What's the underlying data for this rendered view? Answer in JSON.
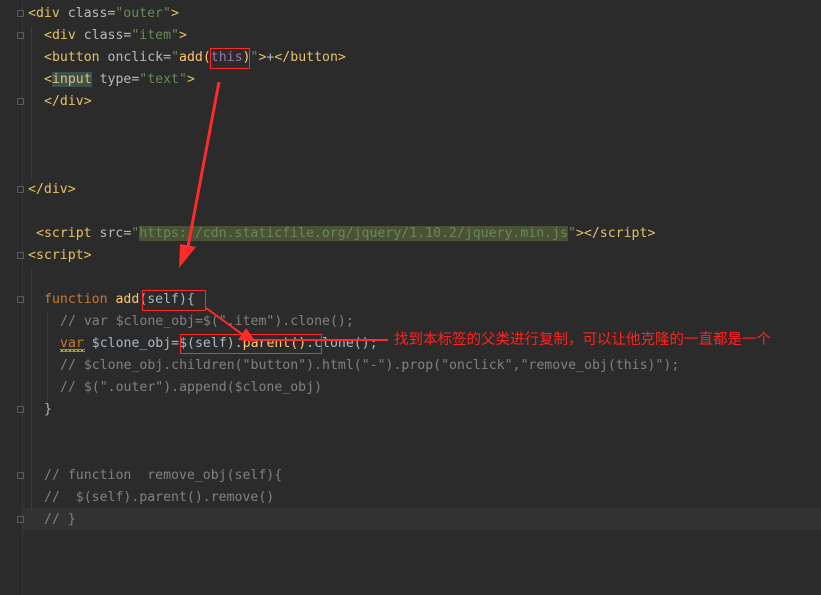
{
  "code": {
    "l1": {
      "open": "<",
      "tag": "div",
      "attr": " class=",
      "val": "\"outer\"",
      "close": ">"
    },
    "l2": {
      "open": "<",
      "tag": "div",
      "attr": " class=",
      "val": "\"item\"",
      "close": ">"
    },
    "l3": {
      "open": "<",
      "tag": "button",
      "attr": " onclick=",
      "q1": "\"",
      "fn": "add(",
      "arg": "this",
      "rp": ")",
      "q2": "\"",
      "close": ">",
      "text": "+",
      "end_open": "</",
      "end_tag": "button",
      "end_close": ">"
    },
    "l4": {
      "open": "<",
      "tag": "input",
      "attr": " type=",
      "val": "\"text\"",
      "close": ">"
    },
    "l5": {
      "open": "</",
      "tag": "div",
      "close": ">"
    },
    "l9": {
      "open": "</",
      "tag": "div",
      "close": ">"
    },
    "l11": {
      "open": "<",
      "tag": "script",
      "attr": " src=",
      "q1": "\"",
      "url": "https://cdn.staticfile.org/jquery/1.10.2/jquery.min.js",
      "q2": "\"",
      "close": ">",
      "end_open": "</",
      "end_tag": "script",
      "end_close": ">"
    },
    "l12": {
      "open": "<",
      "tag": "script",
      "close": ">"
    },
    "l14": {
      "kw": "function",
      "name": " add",
      "params": "(self){"
    },
    "l15": {
      "comment": "// var $clone_obj=$(\".item\").clone();"
    },
    "l16": {
      "kw": "var",
      "name": " $clone_obj=",
      "call1": "$(self)",
      "dot1": ".",
      "call2": "parent()",
      "rest": ".clone();"
    },
    "l17": {
      "comment": "// $clone_obj.children(\"button\").html(\"-\").prop(\"onclick\",\"remove_obj(this)\");"
    },
    "l18": {
      "comment": "// $(\".outer\").append($clone_obj)"
    },
    "l19": {
      "brace": "}"
    },
    "l22": {
      "comment": "// function  remove_obj(self){"
    },
    "l23": {
      "comment": "//  $(self).parent().remove()"
    },
    "l24": {
      "comment": "// }"
    }
  },
  "annotation": {
    "text": "找到本标签的父类进行复制，可以让他克隆的一直都是一个",
    "color": "#ff2222"
  },
  "colors": {
    "background": "#2b2b2b",
    "tag": "#e8bf6a",
    "string": "#6a8759",
    "keyword": "#cc7832",
    "function": "#ffc66d",
    "comment": "#808080",
    "arrow": "#ff2a2a"
  }
}
